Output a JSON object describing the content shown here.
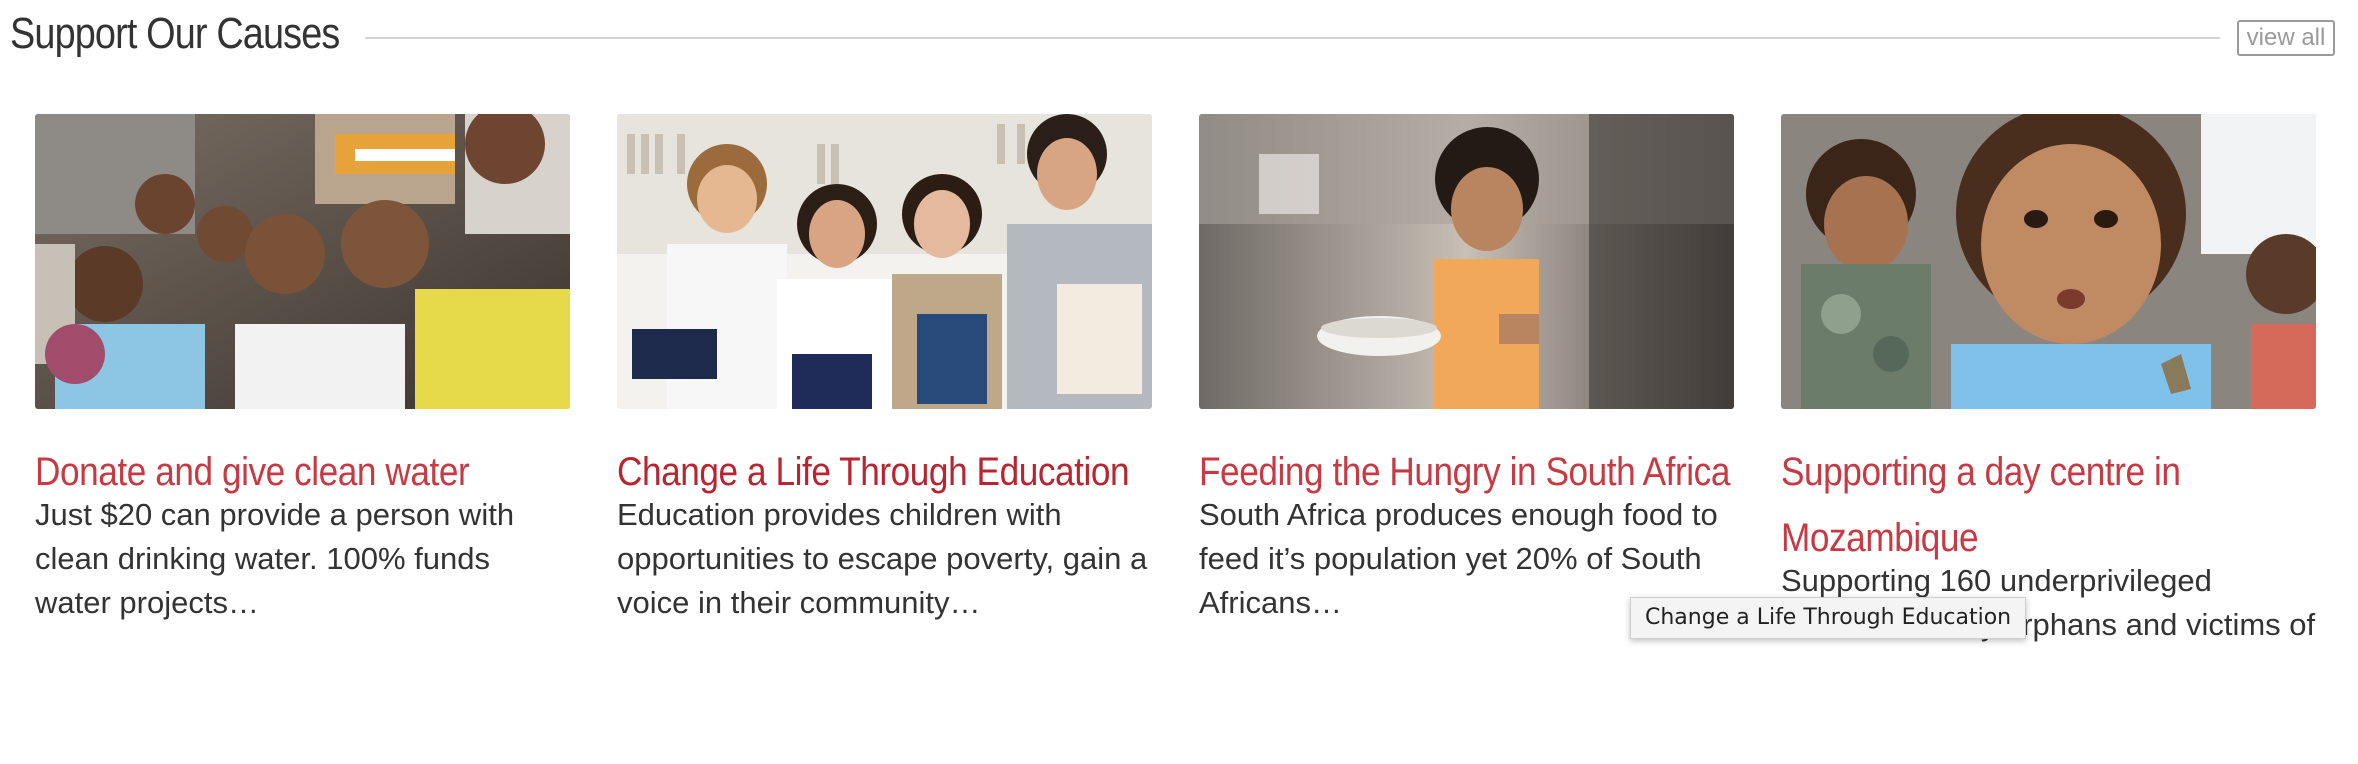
{
  "section": {
    "title": "Support Our Causes",
    "view_all_label": "view all"
  },
  "causes": [
    {
      "title": "Donate and give clean water",
      "description": "Just $20 can provide a person with clean drinking water. 100% funds water projects…",
      "image": "group of smiling children"
    },
    {
      "title": "Change a Life Through Education",
      "description": "Education provides children with opportunities to escape poverty, gain a voice in their community…",
      "image": "four smiling students holding books"
    },
    {
      "title": "Feeding the Hungry in South Africa",
      "description": "South Africa produces enough food to feed it’s population yet 20% of South Africans…",
      "image": "child holding a bowl of food"
    },
    {
      "title": "Supporting a day centre in Mozambique",
      "description": "Supporting 160 underprivileged children, mostly orphans and victims of",
      "image": "close-up of a young child"
    }
  ],
  "tooltip": {
    "text": "Change a Life Through Education"
  },
  "colors": {
    "accent": "#c73a44",
    "accent_hover": "#b8242f",
    "text": "#333333",
    "rule": "#d3d3d3",
    "button_border": "#9a9a9a"
  }
}
